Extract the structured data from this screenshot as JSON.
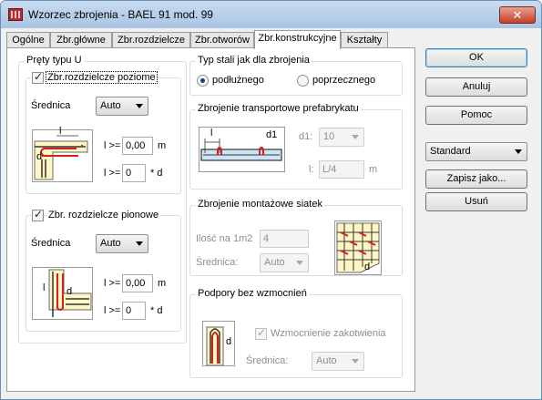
{
  "window": {
    "title": "Wzorzec zbrojenia - BAEL 91 mod. 99",
    "close_glyph": "✕"
  },
  "tabs": [
    {
      "label": "Ogólne"
    },
    {
      "label": "Zbr.główne"
    },
    {
      "label": "Zbr.rozdzielcze"
    },
    {
      "label": "Zbr.otworów"
    },
    {
      "label": "Zbr.konstrukcyjne",
      "active": true
    },
    {
      "label": "Kształty"
    }
  ],
  "u_bars": {
    "title": "Pręty typu U",
    "horizontal": {
      "checkbox_label": "Zbr.rozdzielcze poziome",
      "checked": true,
      "diameter_label": "Średnica",
      "diameter_value": "Auto",
      "l_label1": "l >=",
      "l_value1": "0,00",
      "l_unit1": "m",
      "l_label2": "l >=",
      "l_value2": "0",
      "l_unit2": "* d",
      "fig_l": "l",
      "fig_d": "d"
    },
    "vertical": {
      "checkbox_label": "Zbr. rozdzielcze pionowe",
      "checked": true,
      "diameter_label": "Średnica",
      "diameter_value": "Auto",
      "l_label1": "l >=",
      "l_value1": "0,00",
      "l_unit1": "m",
      "l_label2": "l >=",
      "l_value2": "0",
      "l_unit2": "* d",
      "fig_l": "l",
      "fig_d": "d"
    }
  },
  "steel_type": {
    "title": "Typ stali jak dla zbrojenia",
    "options": [
      {
        "label": "podłużnego",
        "selected": true
      },
      {
        "label": "poprzecznego",
        "selected": false
      }
    ]
  },
  "transport": {
    "title": "Zbrojenie transportowe prefabrykatu",
    "d1_label": "d1:",
    "d1_value": "10",
    "l_label": "l:",
    "l_value": "L/4",
    "l_unit": "m",
    "fig_l": "l",
    "fig_d1": "d1"
  },
  "mesh": {
    "title": "Zbrojenie montażowe siatek",
    "count_label": "Ilość na 1m2",
    "count_value": "4",
    "diameter_label": "Średnica:",
    "diameter_value": "Auto",
    "fig_d": "d"
  },
  "supports": {
    "title": "Podpory bez wzmocnień",
    "checkbox_label": "Wzmocnienie zakotwienia",
    "checked": true,
    "diameter_label": "Średnica:",
    "diameter_value": "Auto",
    "fig_d": "d"
  },
  "buttons": {
    "ok": "OK",
    "cancel": "Anuluj",
    "help": "Pomoc",
    "preset_value": "Standard",
    "save_as": "Zapisz jako...",
    "delete": "Usuń"
  },
  "colors": {
    "rebar": "#d42020",
    "accent_blue": "#1d3f7a"
  }
}
